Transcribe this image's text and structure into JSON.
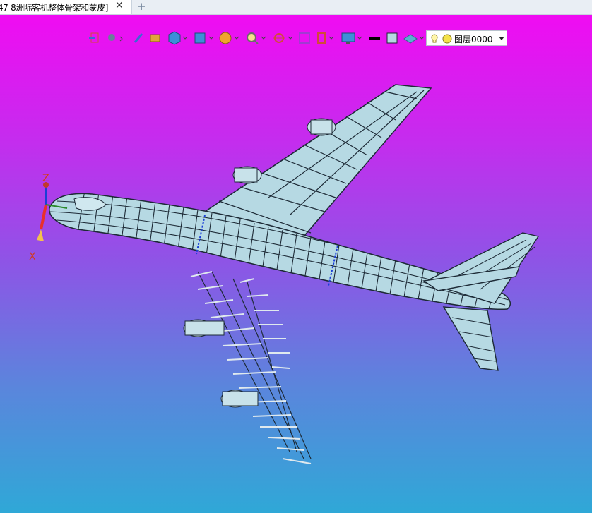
{
  "tab": {
    "title": "47-8洲际客机整体骨架和蒙皮]",
    "close_glyph": "✕",
    "add_glyph": "+"
  },
  "toolbar": {
    "icons": [
      "import-icon",
      "move-tool-icon",
      "pen-icon",
      "eraser-box-icon",
      "cube-view-icon",
      "display-mode-icon",
      "render-sphere-icon",
      "zoom-icon",
      "rotate-icon",
      "fit-view-icon",
      "section-icon",
      "monitor-icon",
      "line-style-icon",
      "color-swatch-icon",
      "layer-stack-icon"
    ],
    "layer": {
      "label": "图层0000"
    }
  },
  "axis": {
    "z_label": "Z",
    "x_label": "X"
  },
  "colors": {
    "bg_top": "#f00cf2",
    "bg_bottom": "#2fa8d7",
    "skin": "#b6d9e3",
    "frame": "#1d2a36",
    "accent_blue": "#1b3fd6"
  }
}
